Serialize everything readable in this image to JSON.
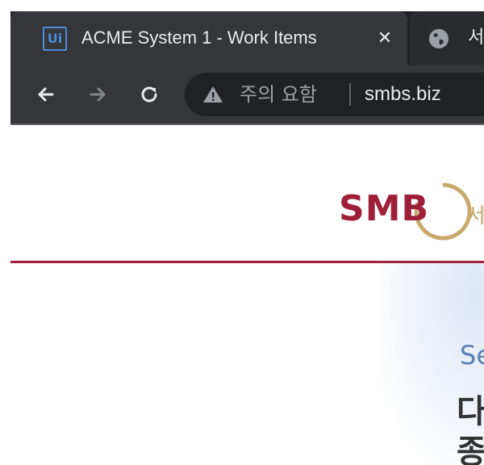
{
  "browser": {
    "tabs": [
      {
        "title": "ACME System 1 - Work Items",
        "favicon": "Ui"
      },
      {
        "title": "서"
      }
    ],
    "omnibox": {
      "warning": "주의 요함",
      "url": "smbs.biz"
    }
  },
  "page": {
    "logo": {
      "text": "SMB",
      "suffix": "서"
    },
    "hero": {
      "subtitle": "Se",
      "line1": "다",
      "line2": "종"
    }
  },
  "colors": {
    "tab_strip": "#202124",
    "active_tab": "#35363a",
    "brand_red": "#9e1f3a",
    "brand_gold": "#c8a96b",
    "hero_blue": "#5b7fb3"
  },
  "icons": {
    "favicon": "uipath-icon",
    "tab2": "globe-icon",
    "back": "arrow-left-icon",
    "forward": "arrow-right-icon",
    "reload": "reload-icon",
    "security": "warning-triangle-icon",
    "close": "close-icon"
  }
}
